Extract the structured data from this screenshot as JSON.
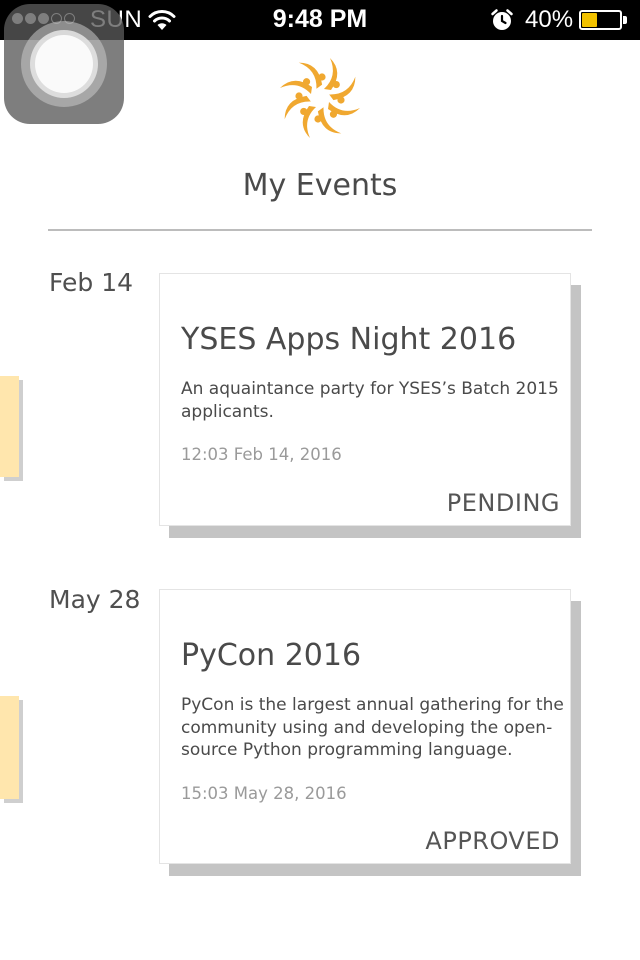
{
  "status_bar": {
    "carrier": "SUN",
    "signal_strength_dots_filled": 3,
    "signal_strength_dots_total": 5,
    "time": "9:48 PM",
    "battery_percent": "40%",
    "battery_level": 0.4,
    "battery_color": "#f2c200",
    "icons": [
      "wifi-icon",
      "alarm-clock-icon",
      "battery-icon"
    ]
  },
  "header": {
    "logo_icon": "sunburst-logo-icon",
    "logo_color": "#f0a830",
    "title": "My Events"
  },
  "events": [
    {
      "date": "Feb 14",
      "title": "YSES Apps Night 2016",
      "description": "An aquaintance party for YSES’s Batch 2015 applicants.",
      "timestamp": "12:03 Feb 14, 2016",
      "status": "PENDING"
    },
    {
      "date": "May 28",
      "title": "PyCon 2016",
      "description": "PyCon is the largest annual gathering for the community using and developing the open-source Python programming language.",
      "timestamp": "15:03 May 28, 2016",
      "status": "APPROVED"
    }
  ],
  "colors": {
    "side_tab": "#ffe6ad",
    "card_shadow": "#c4c4c4",
    "divider": "#bcbcbc"
  }
}
